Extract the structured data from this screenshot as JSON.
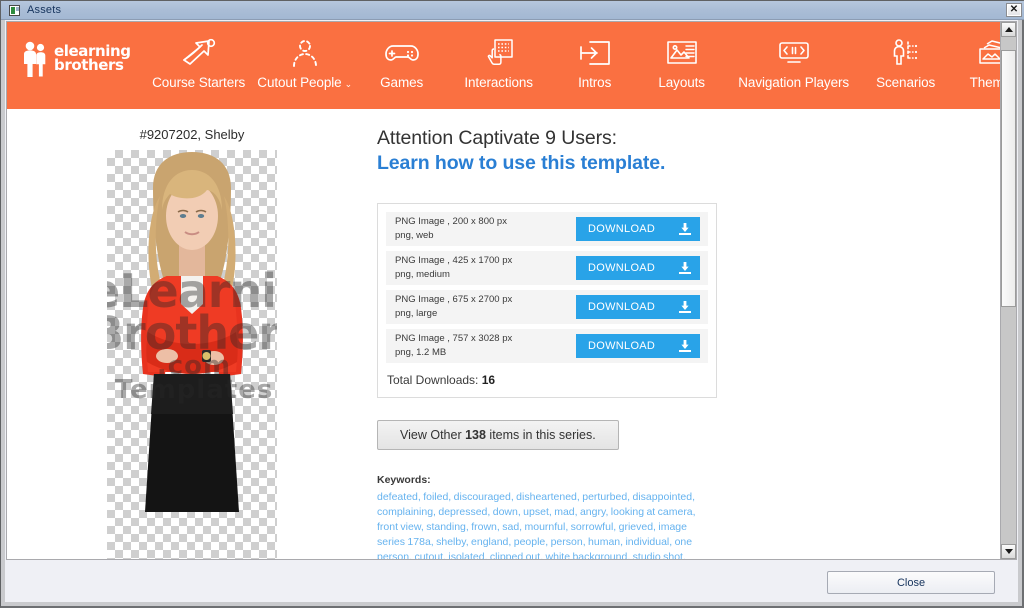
{
  "window": {
    "title": "Assets",
    "title_icon": "app-window-icon",
    "close_icon": "close-x-icon"
  },
  "nav": {
    "brand": {
      "line1": "elearning",
      "line2": "brothers",
      "mark": "two-people-logo-icon"
    },
    "items": [
      {
        "label": "Course Starters",
        "icon": "arrow-flag-icon",
        "has_caret": false
      },
      {
        "label": "Cutout People",
        "icon": "dashed-person-icon",
        "has_caret": true
      },
      {
        "label": "Games",
        "icon": "gamepad-icon",
        "has_caret": false
      },
      {
        "label": "Interactions",
        "icon": "hand-click-chart-icon",
        "has_caret": false
      },
      {
        "label": "Intros",
        "icon": "arrow-into-box-icon",
        "has_caret": false
      },
      {
        "label": "Layouts",
        "icon": "image-text-layout-icon",
        "has_caret": false
      },
      {
        "label": "Navigation Players",
        "icon": "media-player-icon",
        "has_caret": false
      },
      {
        "label": "Scenarios",
        "icon": "person-decision-icon",
        "has_caret": false
      },
      {
        "label": "Themes",
        "icon": "stacked-cards-icon",
        "has_caret": false
      }
    ],
    "caret_glyph": "⌄",
    "background_color": "#fa7041"
  },
  "asset": {
    "title": "#9207202, Shelby",
    "watermark_line1": "eLearning",
    "watermark_line2": "Brothers",
    "watermark_line3": ".com",
    "watermark_line4": "Templates"
  },
  "main": {
    "headline": "Attention Captivate 9 Users:",
    "headline_link": "Learn how to use this template.",
    "headline_link_color": "#2a7fd4",
    "downloads": [
      {
        "line1": "PNG Image , 200 x 800 px",
        "line2": "png, web",
        "button": "DOWNLOAD",
        "icon": "download-tray-icon"
      },
      {
        "line1": "PNG Image , 425 x 1700 px",
        "line2": "png, medium",
        "button": "DOWNLOAD",
        "icon": "download-tray-icon"
      },
      {
        "line1": "PNG Image , 675 x 2700 px",
        "line2": "png, large",
        "button": "DOWNLOAD",
        "icon": "download-tray-icon"
      },
      {
        "line1": "PNG Image , 757 x 3028 px",
        "line2": "png, 1.2 MB",
        "button": "DOWNLOAD",
        "icon": "download-tray-icon"
      }
    ],
    "total_downloads_label": "Total Downloads: ",
    "total_downloads_value": "16",
    "view_other_prefix": "View Other ",
    "view_other_count": "138",
    "view_other_suffix": " items in this series.",
    "keywords_label": "Keywords:",
    "keywords": "defeated, foiled, discouraged, disheartened, perturbed, disappointed, complaining, depressed, down, upset, mad, angry, looking at camera, front view, standing, frown, sad, mournful, sorrowful, grieved, image series 178a, shelby, england, people, person, human, individual, one person, cutout, isolated, clipped out, white background, studio shot, business, professional,"
  },
  "scrollbar": {
    "up_icon": "scroll-up-arrow-icon",
    "down_icon": "scroll-down-arrow-icon"
  },
  "footer": {
    "close_label": "Close"
  }
}
